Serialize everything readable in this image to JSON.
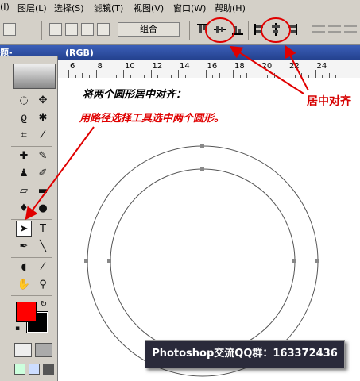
{
  "menu": {
    "items": [
      "(I)",
      "图层(L)",
      "选择(S)",
      "滤镜(T)",
      "视图(V)",
      "窗口(W)",
      "帮助(H)"
    ]
  },
  "options_bar": {
    "group_label": "组合"
  },
  "document": {
    "title_fragment": "题-",
    "mode": "(RGB)"
  },
  "ruler": {
    "labels": [
      "6",
      "8",
      "10",
      "12",
      "14",
      "16",
      "18",
      "20",
      "22",
      "24"
    ]
  },
  "instructions": {
    "step1": "将两个圆形居中对齐：",
    "step2": "用路径选择工具选中两个圆形。"
  },
  "annotation": {
    "center_align_label": "居中对齐"
  },
  "banner": {
    "text": "Photoshop交流QQ群：163372436"
  },
  "colors": {
    "foreground": "#ff0000",
    "background": "#000000",
    "annotation_red": "#d60000",
    "title_blue": "#23408c"
  }
}
